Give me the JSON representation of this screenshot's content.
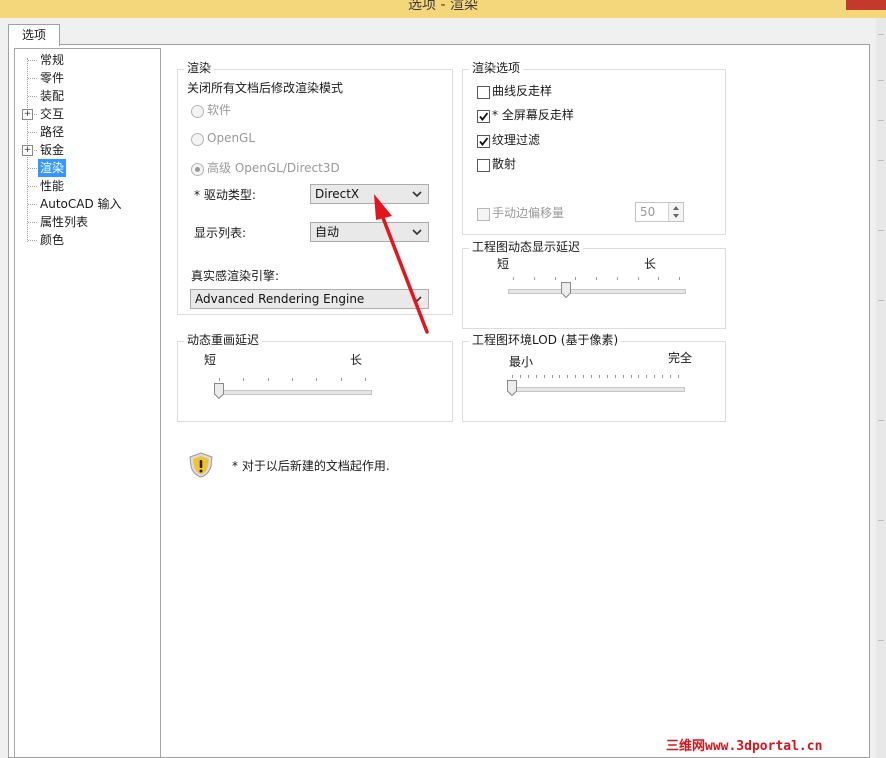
{
  "window": {
    "title": "选项 - 渲染"
  },
  "tab": {
    "label": "选项"
  },
  "tree": {
    "items": [
      {
        "label": "常规",
        "expandable": false
      },
      {
        "label": "零件",
        "expandable": false
      },
      {
        "label": "装配",
        "expandable": false
      },
      {
        "label": "交互",
        "expandable": true
      },
      {
        "label": "路径",
        "expandable": false
      },
      {
        "label": "钣金",
        "expandable": true
      },
      {
        "label": "渲染",
        "expandable": false,
        "selected": true
      },
      {
        "label": "性能",
        "expandable": false
      },
      {
        "label": "AutoCAD 输入",
        "expandable": false
      },
      {
        "label": "属性列表",
        "expandable": false
      },
      {
        "label": "颜色",
        "expandable": false
      }
    ],
    "expander_glyph": "+"
  },
  "render_group": {
    "title": "渲染",
    "note": "关闭所有文档后修改渲染模式",
    "radio_software": "软件",
    "radio_opengl": "OpenGL",
    "radio_advanced": "高级 OpenGL/Direct3D",
    "driver_type_label": "* 驱动类型:",
    "driver_type_value": "DirectX",
    "display_list_label": "显示列表:",
    "display_list_value": "自动",
    "realistic_engine_label": "真实感渲染引擎:",
    "realistic_engine_value": "Advanced Rendering Engine"
  },
  "render_options": {
    "title": "渲染选项",
    "curve_antialias": "曲线反走样",
    "curve_antialias_checked": false,
    "fullscreen_antialias": "* 全屏幕反走样",
    "fullscreen_antialias_checked": true,
    "texture_filter": "纹理过滤",
    "texture_filter_checked": true,
    "scatter": "散射",
    "scatter_checked": false,
    "manual_edge_offset": "手动边偏移量",
    "manual_edge_offset_checked": false,
    "manual_edge_offset_value": "50"
  },
  "drawing_dynamic_delay": {
    "title": "工程图动态显示延迟",
    "min_label": "短",
    "max_label": "长",
    "level": 0.32
  },
  "dynamic_redraw_delay": {
    "title": "动态重画延迟",
    "min_label": "短",
    "max_label": "长",
    "level": 0.0
  },
  "drawing_env_lod": {
    "title": "工程图环境LOD (基于像素)",
    "min_label": "最小",
    "max_label": "完全",
    "level": 0.0
  },
  "footer_note": "* 对于以后新建的文档起作用.",
  "watermark": "三维网www.3dportal.cn",
  "colors": {
    "selection": "#3399ff",
    "arrow": "#e8141b",
    "warning_shield": "#f2c230"
  }
}
